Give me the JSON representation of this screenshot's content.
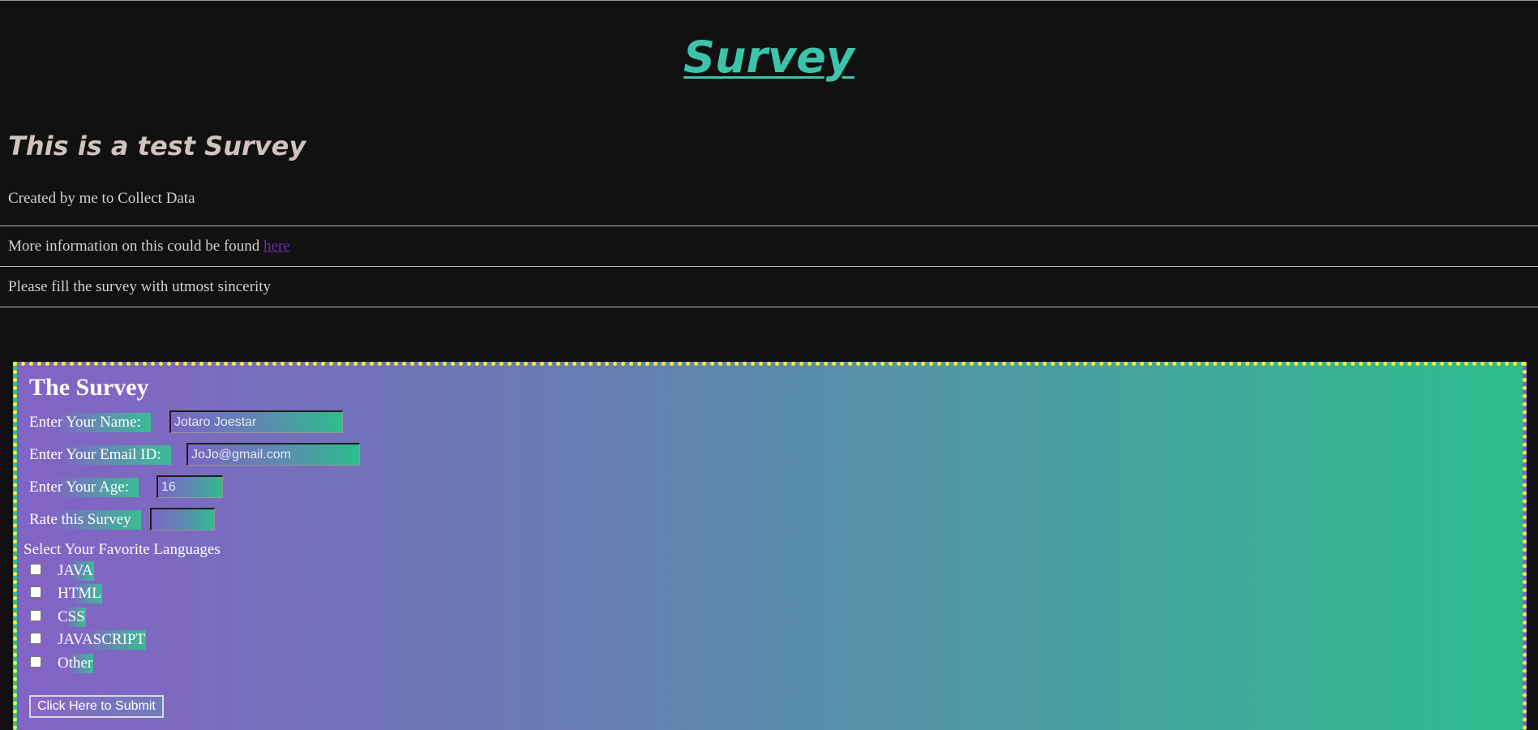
{
  "header": {
    "title": "Survey",
    "subtitle": "This is a test Survey",
    "created_text": "Created by me to Collect Data",
    "info_prefix": "More information on this could be found ",
    "info_link": "here",
    "sincerity_text": "Please fill the survey with utmost sincerity"
  },
  "survey": {
    "heading": "The Survey",
    "name_label": "Enter Your Name:",
    "name_value": "Jotaro Joestar",
    "email_label": "Enter Your Email ID:",
    "email_value": "JoJo@gmail.com",
    "age_label": "Enter Your Age:",
    "age_value": "16",
    "rate_label": "Rate this Survey",
    "rate_value": "",
    "languages_title": "Select Your Favorite Languages",
    "languages": [
      "JAVA",
      "HTML",
      "CSS",
      "JAVASCRIPT",
      "Other"
    ],
    "submit_label": "Click Here to Submit"
  },
  "colors": {
    "title": "#3cc4aa",
    "background": "#111111",
    "survey_border": "#f5ef2c",
    "gradient_start": "#8363c6",
    "gradient_end": "#2dbe8c",
    "link": "#6a2bb0"
  }
}
